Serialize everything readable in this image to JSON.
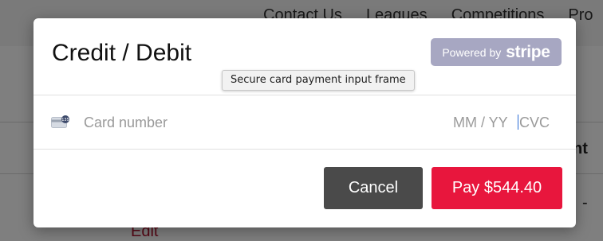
{
  "background": {
    "nav_links": [
      "Contact Us",
      "Leagues",
      "Competitions",
      "Pro"
    ],
    "table_header_fragment": "nt",
    "cell_fragment": "-",
    "edit_link": "Edit"
  },
  "modal": {
    "title": "Credit / Debit",
    "badge": {
      "powered": "Powered by",
      "brand": "stripe"
    },
    "tooltip": "Secure card payment input frame",
    "card_input": {
      "icon": "credit-card-icon",
      "card_number_placeholder": "Card number",
      "expiry_placeholder": "MM / YY",
      "cvc_placeholder": "CVC"
    },
    "buttons": {
      "cancel": "Cancel",
      "pay": "Pay $544.40"
    }
  },
  "colors": {
    "pay_button": "#e8163d",
    "cancel_button": "#4a4a4a",
    "stripe_badge": "#a7a7c2",
    "edit_link": "#b0102c"
  }
}
